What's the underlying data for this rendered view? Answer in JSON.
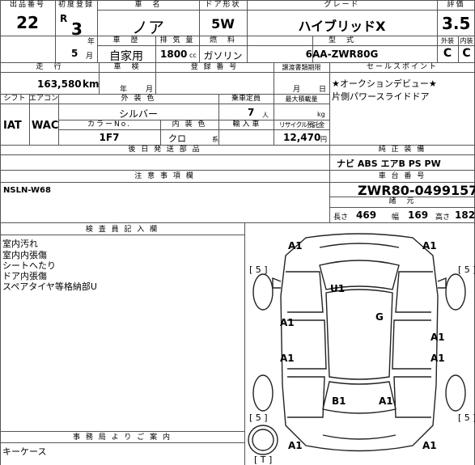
{
  "header": {
    "lot_label": "出品番号",
    "lot_value": "22",
    "first_reg_label": "初度登録",
    "era": "R",
    "year": "3",
    "year_unit": "年",
    "month": "5",
    "month_unit": "月",
    "car_name_label": "車　名",
    "car_name": "ノア",
    "door_label": "ドア形状",
    "door": "5W",
    "grade_label": "グレード",
    "grade": "ハイブリッドX",
    "score_label": "評価",
    "score": "3.5",
    "usage_label": "車　歴",
    "usage": "自家用",
    "displacement_label": "排 気 量",
    "displacement": "1800",
    "displacement_unit": "cc",
    "fuel_label": "燃　料",
    "fuel": "ガソリン",
    "model_label": "型　式",
    "model": "6AA-ZWR80G",
    "exterior_grade_label": "外装",
    "exterior_grade": "C",
    "interior_grade_label": "内装",
    "interior_grade": "C"
  },
  "row2": {
    "mileage_label": "走　行",
    "mileage": "163,580",
    "mileage_unit": "km",
    "inspection_label": "車　検",
    "inspection_year_unit": "年",
    "inspection_month_unit": "月",
    "reg_no_label": "登 録 番 号",
    "transfer_label": "譲渡書類期限",
    "transfer_month_unit": "月",
    "transfer_day_unit": "日",
    "sales_point_label": "セールスポイント",
    "sales_points": [
      "★オークションデビュー★",
      "片側パワースライドドア"
    ]
  },
  "row3": {
    "shift_label": "シフト",
    "shift": "IAT",
    "ac_label": "エアコン",
    "ac": "WAC",
    "ext_color_label": "外 装 色",
    "ext_color": "シルバー",
    "capacity_label": "乗車定員",
    "capacity": "7",
    "capacity_unit": "人",
    "max_load_label": "最大積載量",
    "max_load_unit": "kg",
    "color_no_label": "カラーNo.",
    "color_no": "1F7",
    "int_color_label": "内 装 色",
    "int_color": "クロ",
    "int_color_unit": "系",
    "import_label": "輸 入 車",
    "recycle_label": "リサイクル預託金",
    "recycle": "12,470",
    "recycle_unit": "円",
    "later_parts_label": "後 日 発 送 部 品"
  },
  "equipment": {
    "label": "純 正 装 備",
    "value": "ナビ ABS エアB PS PW"
  },
  "notes": {
    "label": "注 意 事 項 欄",
    "value": "NSLN-W68"
  },
  "chassis": {
    "label": "車 台 番 号",
    "value": "ZWR80-0499157",
    "dims_label": "諸　元",
    "length_label": "長さ",
    "length": "469",
    "width_label": "幅",
    "width": "169",
    "height_label": "高さ",
    "height": "182"
  },
  "inspector": {
    "label": "検 査 員 記 入 欄",
    "lines": [
      "室内汚れ",
      "室内内張傷",
      "シートへたり",
      "ドア内張傷",
      "スペアタイヤ等格納部U"
    ]
  },
  "office": {
    "label": "事 務 局 よ り ご 案 内",
    "value": "キーケース"
  },
  "diagram": {
    "marks": [
      "A1",
      "A1",
      "U1",
      "G",
      "A1",
      "A1",
      "A1",
      "A1",
      "B1",
      "A1",
      "A1",
      "A1"
    ],
    "brackets": [
      "[ 5 ]",
      "[ 5 ]",
      "[ 5 ]",
      "[ 5 ]",
      "[ T ]"
    ]
  }
}
